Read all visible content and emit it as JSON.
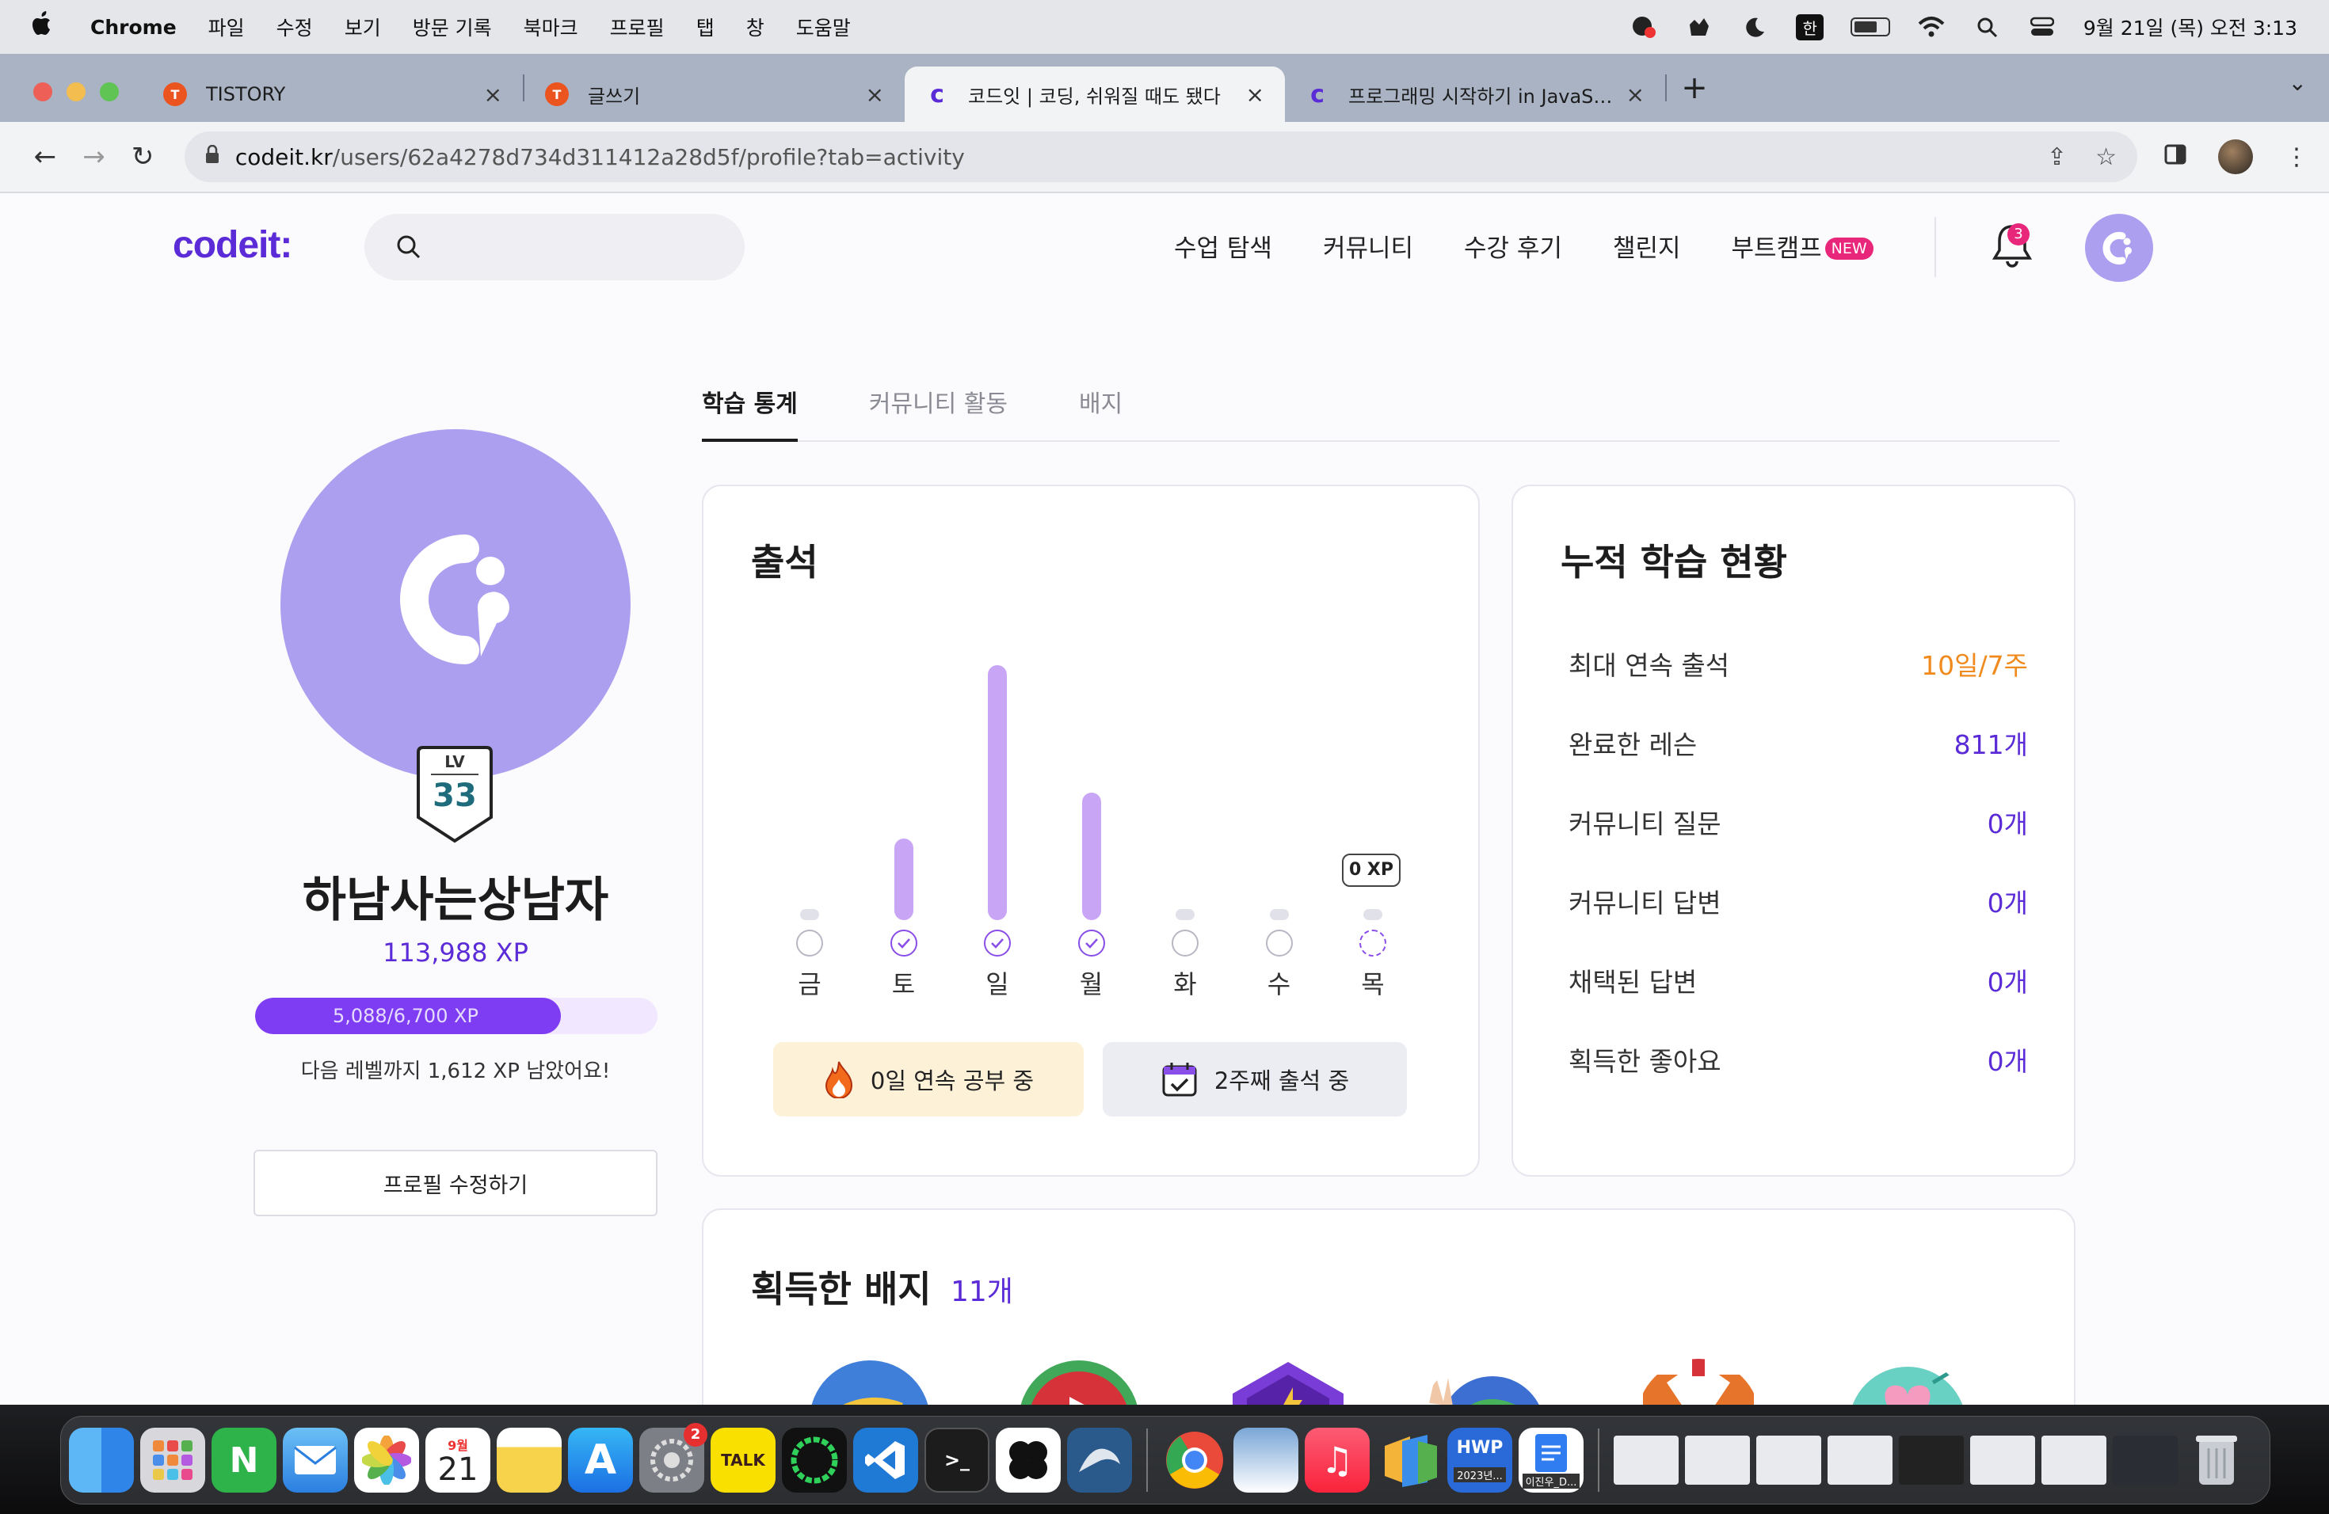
{
  "menubar": {
    "app": "Chrome",
    "items": [
      "파일",
      "수정",
      "보기",
      "방문 기록",
      "북마크",
      "프로필",
      "탭",
      "창",
      "도움말"
    ],
    "ime": "한",
    "clock": "9월 21일 (목) 오전 3:13"
  },
  "tabs": [
    {
      "title": "TISTORY",
      "favicon": "tistory-icon",
      "color": "#eb531f"
    },
    {
      "title": "글쓰기",
      "favicon": "tistory-icon",
      "color": "#eb531f"
    },
    {
      "title": "코드잇 | 코딩, 쉬워질 때도 됐다",
      "favicon": "codeit-icon",
      "color": "#5a2bd6"
    },
    {
      "title": "프로그래밍 시작하기 in JavaScript",
      "favicon": "codeit-icon",
      "color": "#5a2bd6"
    }
  ],
  "active_tab": 2,
  "address": {
    "host": "codeit.kr",
    "path": "/users/62a4278d734d311412a28d5f/profile?tab=activity"
  },
  "site": {
    "logo": "codeit:",
    "nav": [
      "수업 탐색",
      "커뮤니티",
      "수강 후기",
      "챌린지",
      "부트캠프"
    ],
    "new_badge": "NEW",
    "notification_count": "3"
  },
  "profile": {
    "level_label": "LV",
    "level": "33",
    "nickname": "하남사는상남자",
    "xp_total": "113,988 XP",
    "xp_progress_label": "5,088/6,700 XP",
    "xp_progress_fraction": 0.759,
    "xp_remaining": "다음 레벨까지 1,612 XP 남았어요!",
    "edit_button": "프로필 수정하기"
  },
  "profile_tabs": [
    "학습 통계",
    "커뮤니티 활동",
    "배지"
  ],
  "attendance": {
    "title": "출석",
    "days": [
      {
        "label": "금",
        "level": 0,
        "checked": false
      },
      {
        "label": "토",
        "level": 0.32,
        "checked": true
      },
      {
        "label": "일",
        "level": 1.0,
        "checked": true
      },
      {
        "label": "월",
        "level": 0.5,
        "checked": true
      },
      {
        "label": "화",
        "level": 0,
        "checked": false
      },
      {
        "label": "수",
        "level": 0,
        "checked": false
      },
      {
        "label": "목",
        "level": 0,
        "checked": false,
        "today": true
      }
    ],
    "today_xp": "0 XP",
    "streak_study": "0일 연속 공부 중",
    "streak_week": "2주째 출석 중"
  },
  "stats": {
    "title": "누적 학습 현황",
    "rows": [
      {
        "label": "최대 연속 출석",
        "value": "10일/7주",
        "accent": "orange"
      },
      {
        "label": "완료한 레슨",
        "value": "811개"
      },
      {
        "label": "커뮤니티 질문",
        "value": "0개"
      },
      {
        "label": "커뮤니티 답변",
        "value": "0개"
      },
      {
        "label": "채택된 답변",
        "value": "0개"
      },
      {
        "label": "획득한 좋아요",
        "value": "0개"
      }
    ]
  },
  "badges": {
    "title": "획득한 배지",
    "count": "11개"
  },
  "dock": {
    "calendar_month": "9월",
    "calendar_day": "21",
    "settings_badge": "2",
    "kakao_label": "TALK",
    "hwp_label": "HWP",
    "hwp_caption": "2023년...",
    "doc_caption": "이진우_D..."
  }
}
